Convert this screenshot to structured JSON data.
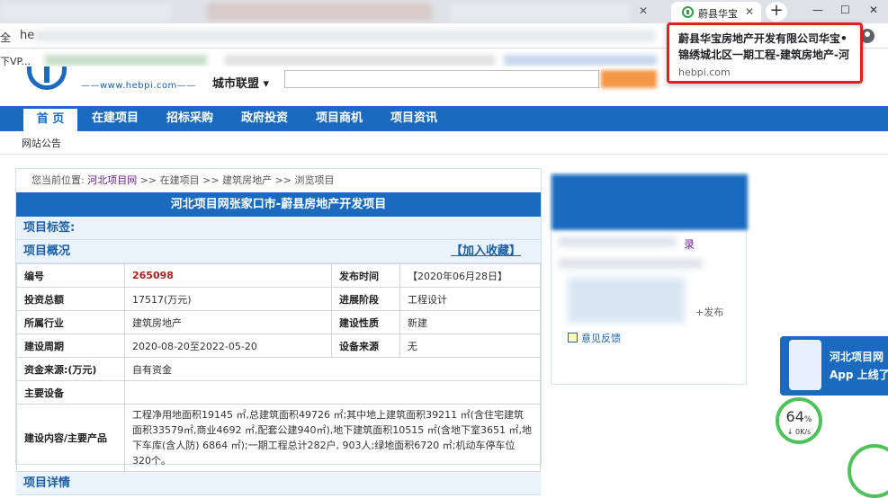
{
  "browser": {
    "active_tab_title": "蔚县华宝",
    "new_tab_symbol": "+",
    "window_minimize": "—",
    "window_restore": "☐",
    "window_close": "✕",
    "tab_close": "✕",
    "address_left": "全",
    "url_fragment": "he",
    "bookmark_first": "下VP...",
    "tooltip": {
      "title": "蔚县华宝房地产开发有限公司华宝•锦绣城北区一期工程-建筑房地产-河北...",
      "domain": "hebpi.com"
    }
  },
  "site": {
    "url_text": "——www.hebpi.com——",
    "city_union": "城市联盟",
    "city_union_arrow": "▾",
    "nav": [
      "首 页",
      "在建项目",
      "招标采购",
      "政府投资",
      "项目商机",
      "项目资讯"
    ],
    "subnav": "网站公告"
  },
  "breadcrumb": {
    "prefix": "您当前位置:",
    "link": "河北项目网",
    "rest": ">> 在建项目 >> 建筑房地产 >> 浏览项目"
  },
  "project": {
    "heading": "河北项目网张家口市-蔚县房地产开发项目",
    "tags_label": "项目标签:",
    "overview_label": "项目概况",
    "add_favorite": "【加入收藏】",
    "rows": [
      {
        "l1": "编号",
        "v1": "265098",
        "l2": "发布时间",
        "v2": "【2020年06月28日】"
      },
      {
        "l1": "投资总额",
        "v1": "17517(万元)",
        "l2": "进展阶段",
        "v2": "工程设计"
      },
      {
        "l1": "所属行业",
        "v1": "建筑房地产",
        "l2": "建设性质",
        "v2": "新建"
      },
      {
        "l1": "建设周期",
        "v1": "2020-08-20至2022-05-20",
        "l2": "设备来源",
        "v2": "无"
      }
    ],
    "fund_label": "资金来源:(万元)",
    "fund_value": "自有资金",
    "equipment_label": "主要设备",
    "equipment_value": "",
    "content_label": "建设内容/主要产品",
    "content_value": "工程净用地面积19145 ㎡,总建筑面积49726 ㎡;其中地上建筑面积39211 ㎡(含住宅建筑面积33579㎡,商业4692 ㎡,配套公建940㎡),地下建筑面积10515 ㎡(含地下室3651 ㎡,地下车库(含人防) 6864 ㎡);一期工程总计282户, 903人;绿地面积6720 ㎡;机动车停车位320个。",
    "next_section": "项目详情"
  },
  "sidebar": {
    "record_text": "录",
    "publish_text": "+发布",
    "feedback": "意见反馈"
  },
  "app_promo": {
    "line1": "河北项目网",
    "line2": "App 上线了"
  },
  "speed_widget": {
    "percent": "64",
    "percent_unit": "%",
    "rate": "0K/s",
    "rate_arrow": "↓"
  },
  "colors": {
    "brand_blue": "#1a6bbf",
    "link_purple": "#6b1e8a",
    "number_red": "#b02020",
    "tooltip_border": "#e02020",
    "speed_green": "#4fc35b"
  }
}
